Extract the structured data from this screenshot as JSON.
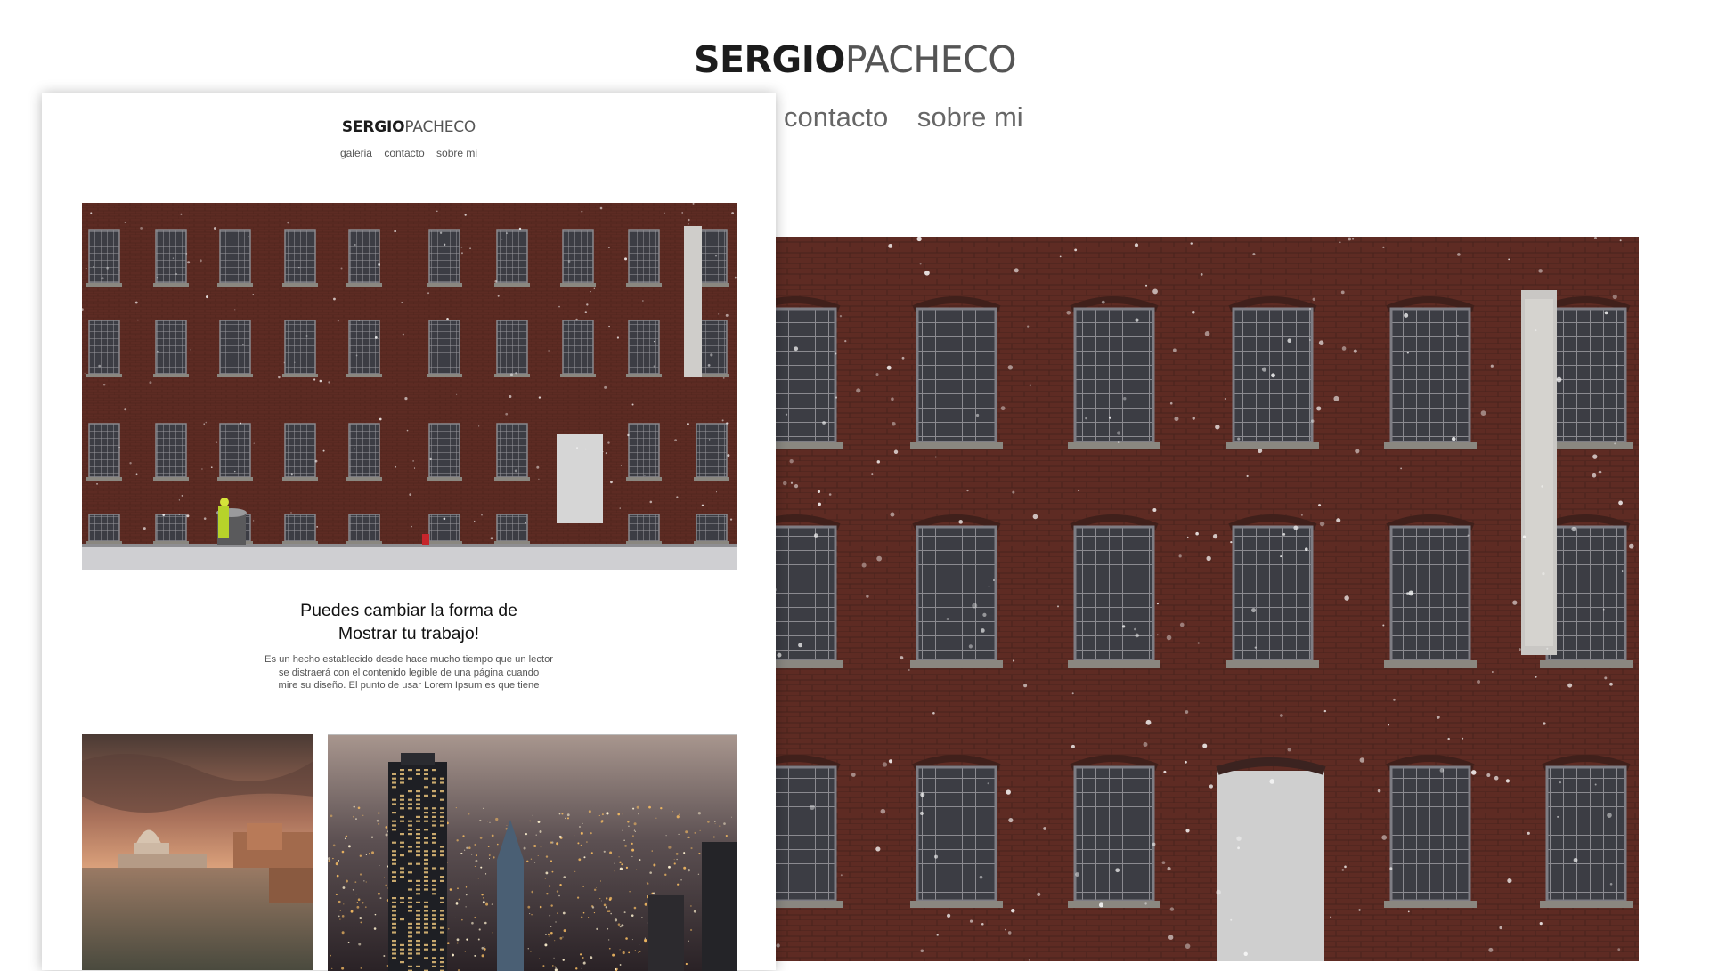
{
  "brand": {
    "bold": "SERGIO",
    "light": "PACHECO"
  },
  "background_site": {
    "nav": [
      "contacto",
      "sobre mi"
    ]
  },
  "card_site": {
    "nav": [
      "galeria",
      "contacto",
      "sobre mi"
    ],
    "heading_line1": "Puedes cambiar la forma de",
    "heading_line2": "Mostrar tu trabajo!",
    "body_line1": "Es un hecho establecido desde hace mucho tiempo que un lector",
    "body_line2": "se distraerá con el contenido legible de una página cuando",
    "body_line3": "mire su diseño. El punto de usar Lorem Ipsum es que tiene"
  },
  "colors": {
    "brick": "#6b3228",
    "brick_dark": "#4e231c",
    "window": "#3a3a3e",
    "text_dark": "#1c1c1c"
  }
}
